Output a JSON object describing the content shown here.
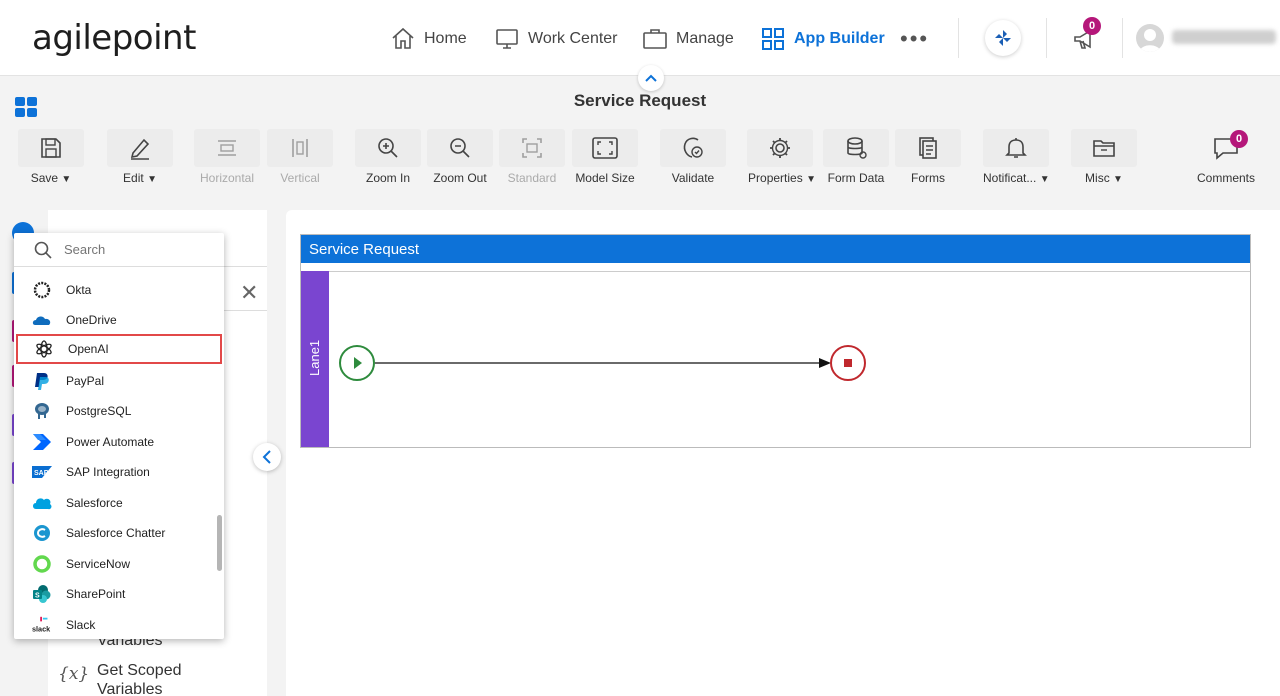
{
  "nav": {
    "logo": "agilepoint",
    "home": "Home",
    "work_center": "Work Center",
    "manage": "Manage",
    "app_builder": "App Builder",
    "more": "•••",
    "notification_count": "0"
  },
  "page_title": "Service Request",
  "toolbar": {
    "save": "Save",
    "edit": "Edit",
    "horizontal": "Horizontal",
    "vertical": "Vertical",
    "zoom_in": "Zoom In",
    "zoom_out": "Zoom Out",
    "standard": "Standard",
    "model_size": "Model Size",
    "validate": "Validate",
    "properties": "Properties",
    "form_data": "Form Data",
    "forms": "Forms",
    "notifications": "Notificat...",
    "misc": "Misc",
    "comments": "Comments",
    "comments_count": "0"
  },
  "left_panel": {
    "items": [
      "Variables",
      "Get Scoped",
      "Variables"
    ]
  },
  "canvas": {
    "pool_title": "Service Request",
    "lane_name": "Lane1"
  },
  "dropdown": {
    "search_placeholder": "Search",
    "items": [
      {
        "label": "Okta",
        "icon": "okta-icon",
        "color": "#222222"
      },
      {
        "label": "OneDrive",
        "icon": "onedrive-icon",
        "color": "#0f6cbd"
      },
      {
        "label": "OpenAI",
        "icon": "openai-icon",
        "color": "#222222",
        "selected": true
      },
      {
        "label": "PayPal",
        "icon": "paypal-icon",
        "color": "#003087"
      },
      {
        "label": "PostgreSQL",
        "icon": "postgresql-icon",
        "color": "#336791"
      },
      {
        "label": "Power Automate",
        "icon": "power-automate-icon",
        "color": "#0066ff"
      },
      {
        "label": "SAP Integration",
        "icon": "sap-icon",
        "color": "#0a6ed1"
      },
      {
        "label": "Salesforce",
        "icon": "salesforce-icon",
        "color": "#00a1e0"
      },
      {
        "label": "Salesforce Chatter",
        "icon": "salesforce-chatter-icon",
        "color": "#1b96d0"
      },
      {
        "label": "ServiceNow",
        "icon": "servicenow-icon",
        "color": "#62d84e"
      },
      {
        "label": "SharePoint",
        "icon": "sharepoint-icon",
        "color": "#038387"
      },
      {
        "label": "Slack",
        "icon": "slack-icon",
        "color": "#222222"
      }
    ]
  },
  "colors": {
    "accent": "#0d72d8",
    "lane": "#7a45d0",
    "badge": "#b5177a",
    "start_event": "#2e8b3d",
    "end_event": "#c0282d"
  }
}
